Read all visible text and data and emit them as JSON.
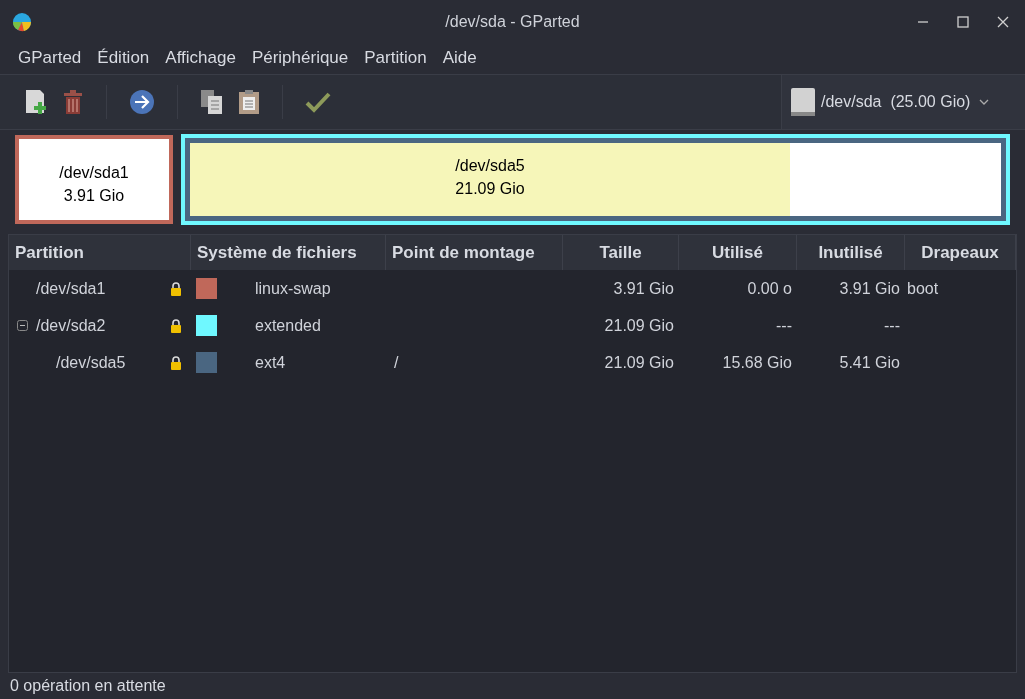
{
  "window": {
    "title": "/dev/sda - GParted"
  },
  "menu": [
    "GParted",
    "Édition",
    "Affichage",
    "Périphérique",
    "Partition",
    "Aide"
  ],
  "device": {
    "name": "/dev/sda",
    "size": "(25.00 Gio)"
  },
  "disk_map": {
    "partitions": [
      {
        "kind": "primary",
        "name": "/dev/sda1",
        "size": "3.91 Gio",
        "color": "#c0685a"
      },
      {
        "kind": "extended",
        "color": "#6ff8ff",
        "children": [
          {
            "name": "/dev/sda5",
            "size": "21.09 Gio",
            "color": "#4a6681",
            "level": 0.74
          }
        ]
      }
    ]
  },
  "table": {
    "columns": [
      "Partition",
      "Système de fichiers",
      "Point de montage",
      "Taille",
      "Utilisé",
      "Inutilisé",
      "Drapeaux"
    ],
    "rows": [
      {
        "partition": "/dev/sda1",
        "locked": true,
        "color": "#c0685a",
        "filesystem": "linux-swap",
        "size": "3.91 Gio",
        "used": "0.00 o",
        "unused": "3.91 Gio",
        "flags": "boot"
      },
      {
        "partition": "/dev/sda2",
        "locked": true,
        "color": "#6ff8ff",
        "filesystem": "extended",
        "size": "21.09 Gio",
        "used": "---",
        "unused": "---",
        "expanded": true,
        "children": [
          {
            "partition": "/dev/sda5",
            "locked": true,
            "color": "#4a6681",
            "filesystem": "ext4",
            "mount": "/",
            "size": "21.09 Gio",
            "used": "15.68 Gio",
            "unused": "5.41 Gio"
          }
        ]
      }
    ]
  },
  "status_bar": "0 opération en attente"
}
